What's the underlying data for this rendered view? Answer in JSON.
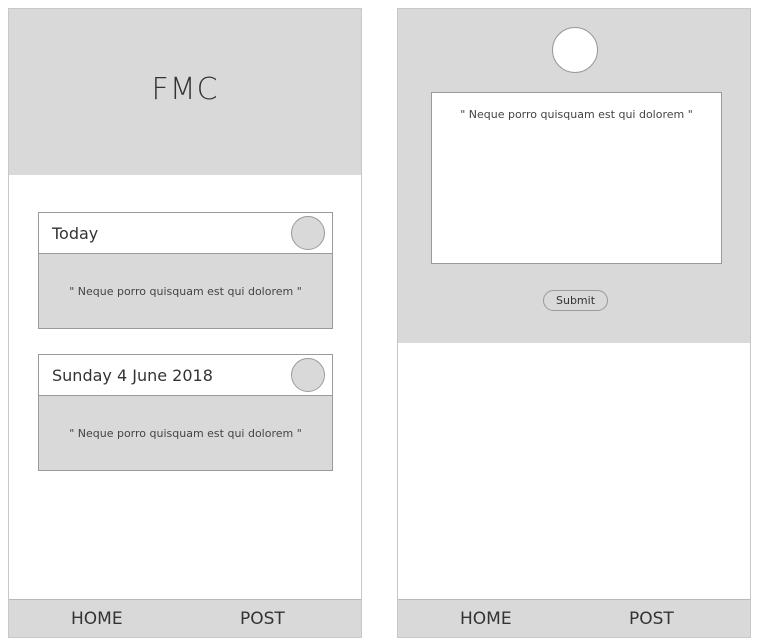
{
  "feed_screen": {
    "header": {
      "title": "FMC"
    },
    "posts": [
      {
        "date": "Today",
        "text": "\" Neque porro quisquam est qui dolorem \""
      },
      {
        "date": "Sunday 4 June 2018",
        "text": "\" Neque porro quisquam est qui dolorem \""
      }
    ],
    "nav": {
      "home_label": "HOME",
      "post_label": "POST"
    }
  },
  "compose_screen": {
    "textarea": {
      "placeholder": "\" Neque porro quisquam est qui dolorem \""
    },
    "submit_label": "Submit",
    "nav": {
      "home_label": "HOME",
      "post_label": "POST"
    }
  },
  "colors": {
    "panel_gray": "#d9d9d9",
    "border_gray": "#9a9a9a",
    "background": "#ffffff"
  }
}
